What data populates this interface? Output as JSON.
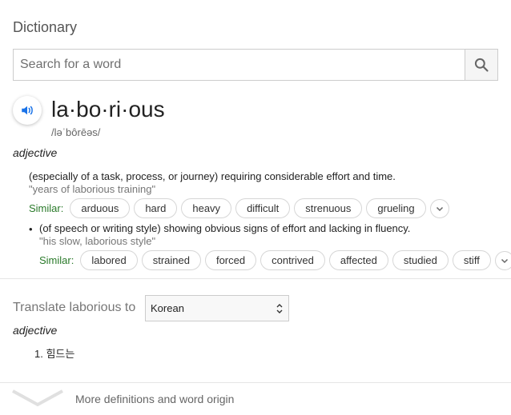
{
  "header": {
    "title": "Dictionary"
  },
  "search": {
    "placeholder": "Search for a word",
    "value": ""
  },
  "entry": {
    "word": "la·bo·ri·ous",
    "phonetic": "/ləˈbôrēəs/",
    "part_of_speech": "adjective",
    "definitions": [
      {
        "text": "(especially of a task, process, or journey) requiring considerable effort and time.",
        "example": "\"years of laborious training\"",
        "similar_label": "Similar:",
        "similar": [
          "arduous",
          "hard",
          "heavy",
          "difficult",
          "strenuous",
          "grueling"
        ]
      },
      {
        "bullet": "•",
        "text": "(of speech or writing style) showing obvious signs of effort and lacking in fluency.",
        "example": "\"his slow, laborious style\"",
        "similar_label": "Similar:",
        "similar": [
          "labored",
          "strained",
          "forced",
          "contrived",
          "affected",
          "studied",
          "stiff"
        ]
      }
    ]
  },
  "translate": {
    "label": "Translate laborious to",
    "selected_language": "Korean",
    "part_of_speech": "adjective",
    "results": [
      {
        "number": "1.",
        "text": "힘드는"
      }
    ]
  },
  "footer": {
    "more_label": "More definitions and word origin"
  },
  "colors": {
    "similar_green": "#2a7a2a",
    "speaker_blue": "#1a73e8"
  }
}
